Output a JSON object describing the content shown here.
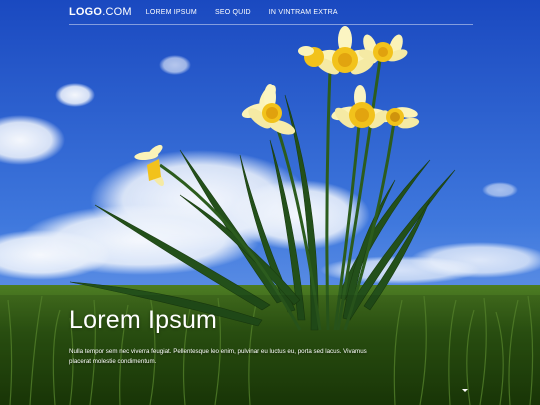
{
  "header": {
    "logo_bold": "LOGO",
    "logo_light": ".COM",
    "nav": [
      {
        "label": "LOREM IPSUM"
      },
      {
        "label": "SEO QUID"
      },
      {
        "label": "IN VINTRAM EXTRA"
      }
    ]
  },
  "hero": {
    "title": "Lorem Ipsum",
    "text": "Nulla tempor sem nec viverra feugiat. Pellentesque leo enim, pulvinar eu luctus eu, porta sed lacus. Vivamus placerat molestie condimentum."
  },
  "colors": {
    "sky_top": "#1b4fc6",
    "sky_bottom": "#5d8fe6",
    "grass": "#2f5a12",
    "petal": "#fbf3b8",
    "trumpet": "#f2c21b"
  }
}
